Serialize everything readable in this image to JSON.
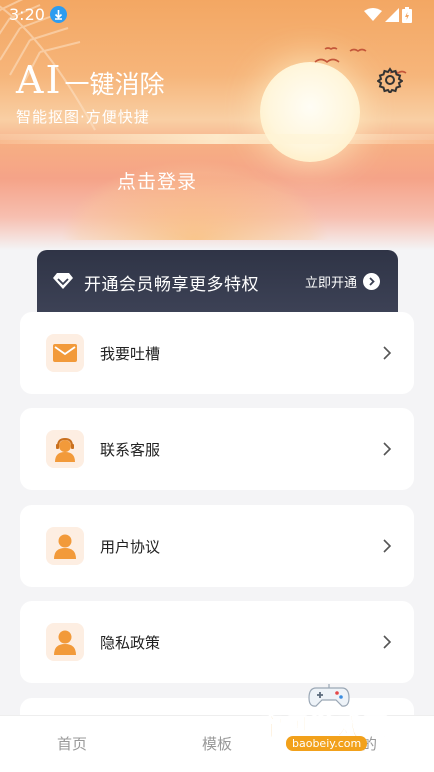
{
  "status_bar": {
    "time": "3:20"
  },
  "header": {
    "title_ai": "AI",
    "title_rest": "一键消除",
    "subtitle": "智能抠图·方便快捷",
    "login": "点击登录"
  },
  "vip_banner": {
    "text": "开通会员畅享更多特权",
    "cta": "立即开通"
  },
  "menu": [
    {
      "label": "我要吐槽",
      "icon": "mail-icon"
    },
    {
      "label": "联系客服",
      "icon": "customer-service-icon"
    },
    {
      "label": "用户协议",
      "icon": "user-icon"
    },
    {
      "label": "隐私政策",
      "icon": "user-icon"
    }
  ],
  "bottom_nav": {
    "home": "首页",
    "templates": "模板",
    "mine": "我的"
  },
  "watermark": {
    "text": "宝贝游戏网",
    "url": "baobeiy.com"
  },
  "colors": {
    "accent": "#f29a3a",
    "icon_bg": "#fdeee2",
    "vip_bg": "#3a3f52"
  }
}
